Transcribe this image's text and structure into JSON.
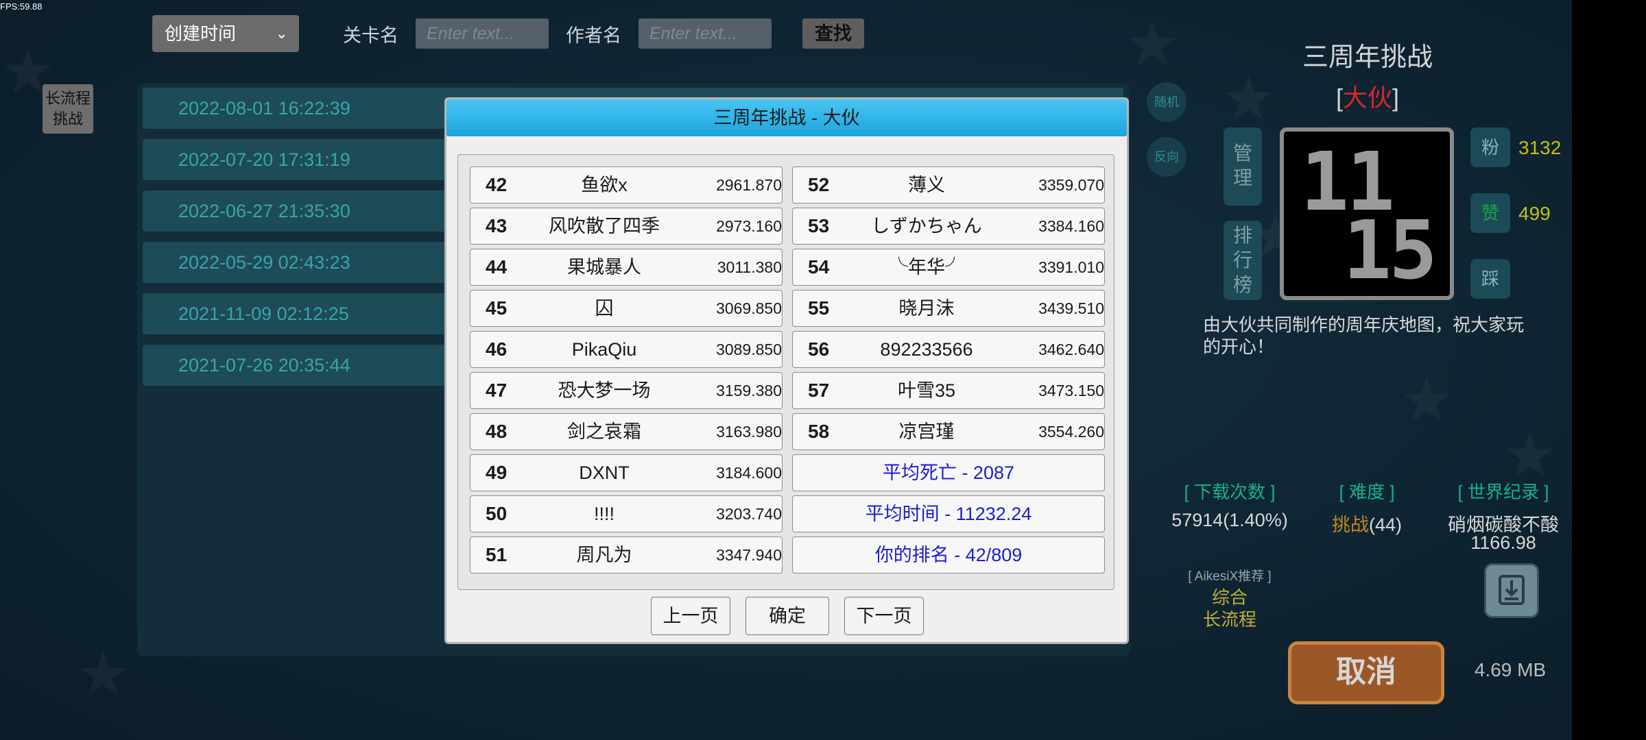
{
  "fps": "FPS:59.88",
  "search": {
    "sort_value": "创建时间",
    "level_name_label": "关卡名",
    "level_name_placeholder": "Enter text...",
    "author_label": "作者名",
    "author_placeholder": "Enter text...",
    "search_label": "查找"
  },
  "side_tag": [
    "长流程",
    "挑战"
  ],
  "list": [
    "2022-08-01 16:22:39",
    "2022-07-20 17:31:19",
    "2022-06-27 21:35:30",
    "2022-05-29 02:43:23",
    "2021-11-09 02:12:25",
    "2021-07-26 20:35:44"
  ],
  "round_buttons": {
    "random": "随机",
    "reverse": "反向"
  },
  "level": {
    "title": "三周年挑战",
    "author_open": "[",
    "author": "大伙",
    "author_close": "]",
    "manage_label": "管理",
    "ranking_label": "排行榜",
    "thumb_top": "11",
    "thumb_bottom": "15",
    "fans_icon": "粉",
    "fans": "3132",
    "likes_icon": "赞",
    "likes": "499",
    "dislike_icon": "踩",
    "description": "由大伙共同制作的周年庆地图，祝大家玩的开心！",
    "downloads_head": "[ 下载次数 ]",
    "downloads": "57914(1.40%)",
    "difficulty_head": "[ 难度 ]",
    "difficulty_word": "挑战",
    "difficulty_num": "(44)",
    "record_head": "[ 世界纪录 ]",
    "record_holder": "硝烟碳酸不酸",
    "record_time": "1166.98",
    "recommend_tag": "[ AikesiX推荐 ]",
    "recommend_1": "综合",
    "recommend_2": "长流程",
    "cancel_label": "取消",
    "size": "4.69 MB"
  },
  "colors": {
    "dialog_title": "#1aa5df",
    "stat_text": "#1c1ccc",
    "author_red": "#d62727",
    "list_text": "#3aa4a8",
    "cancel_bg": "#9b5725"
  },
  "dialog": {
    "title": "三周年挑战 - 大伙",
    "left_col": [
      {
        "rank": "42",
        "name": "鱼欲x",
        "score": "2961.870"
      },
      {
        "rank": "43",
        "name": "风吹散了四季",
        "score": "2973.160"
      },
      {
        "rank": "44",
        "name": "果城暴人",
        "score": "3011.380"
      },
      {
        "rank": "45",
        "name": "囚",
        "score": "3069.850"
      },
      {
        "rank": "46",
        "name": "PikaQiu",
        "score": "3089.850"
      },
      {
        "rank": "47",
        "name": "恐大梦一场",
        "score": "3159.380"
      },
      {
        "rank": "48",
        "name": "剑之哀霜",
        "score": "3163.980"
      },
      {
        "rank": "49",
        "name": "DXNT",
        "score": "3184.600"
      },
      {
        "rank": "50",
        "name": "!!!!",
        "score": "3203.740"
      },
      {
        "rank": "51",
        "name": "周凡为",
        "score": "3347.940"
      }
    ],
    "right_col": [
      {
        "rank": "52",
        "name": "薄义",
        "score": "3359.070"
      },
      {
        "rank": "53",
        "name": "しずかちゃん",
        "score": "3384.160"
      },
      {
        "rank": "54",
        "name": "╰年华╯",
        "score": "3391.010"
      },
      {
        "rank": "55",
        "name": "晓月沫",
        "score": "3439.510"
      },
      {
        "rank": "56",
        "name": "892233566",
        "score": "3462.640"
      },
      {
        "rank": "57",
        "name": "叶雪35",
        "score": "3473.150"
      },
      {
        "rank": "58",
        "name": "凉宫瑾",
        "score": "3554.260"
      }
    ],
    "avg_deaths": "平均死亡 - 2087",
    "avg_time": "平均时间 - 11232.24",
    "your_rank": "你的排名 - 42/809",
    "prev_label": "上一页",
    "ok_label": "确定",
    "next_label": "下一页"
  }
}
